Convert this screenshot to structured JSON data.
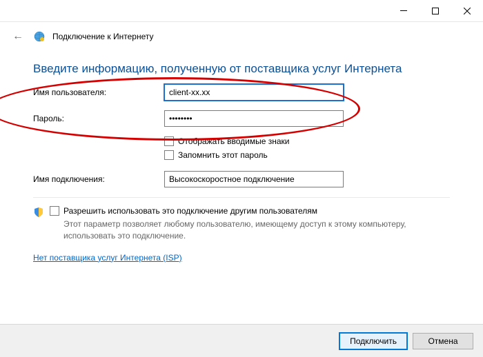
{
  "window": {
    "title": "Подключение к Интернету"
  },
  "heading": "Введите информацию, полученную от поставщика услуг Интернета",
  "fields": {
    "username": {
      "label": "Имя пользователя:",
      "value": "client-xx.xx"
    },
    "password": {
      "label": "Пароль:",
      "value": "••••••••"
    },
    "showChars": {
      "label": "Отображать вводимые знаки"
    },
    "remember": {
      "label": "Запомнить этот пароль"
    },
    "connectionName": {
      "label": "Имя подключения:",
      "value": "Высокоскоростное подключение"
    }
  },
  "share": {
    "label": "Разрешить использовать это подключение другим пользователям",
    "desc": "Этот параметр позволяет любому пользователю, имеющему доступ к этому компьютеру, использовать это подключение."
  },
  "link": "Нет поставщика услуг Интернета (ISP)",
  "buttons": {
    "connect": "Подключить",
    "cancel": "Отмена"
  }
}
